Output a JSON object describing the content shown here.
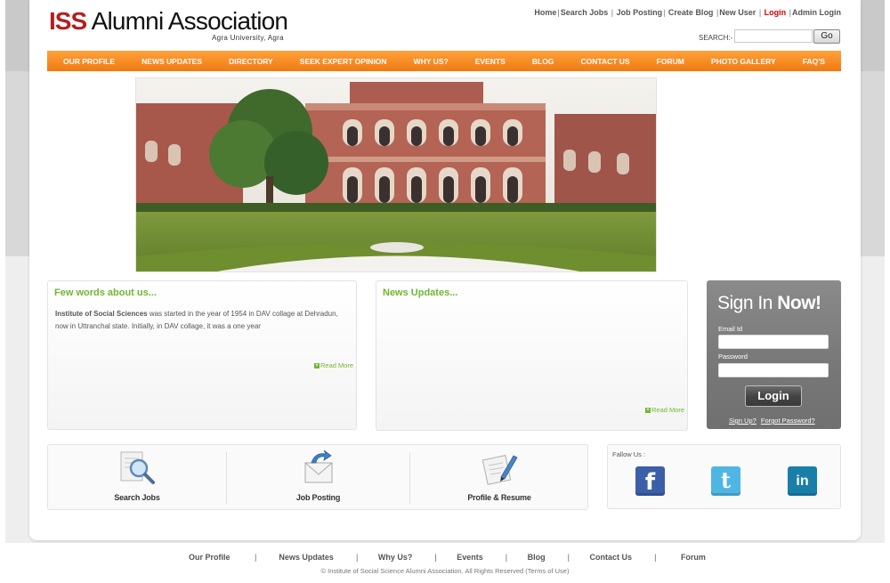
{
  "header": {
    "logo_iss": "ISS",
    "logo_rest": " Alumni Association",
    "logo_sub": "Agra University, Agra",
    "top_links": [
      "Home",
      "Search Jobs",
      "Job Posting",
      "Create Blog",
      "New User",
      "Login",
      "Admin Login"
    ],
    "search_label": "SEARCH:-",
    "search_value": "",
    "search_button": "Go"
  },
  "nav": {
    "items": [
      "OUR PROFILE",
      "NEWS UPDATES",
      "DIRECTORY",
      "SEEK EXPERT OPINION",
      "WHY US?",
      "EVENTS",
      "BLOG",
      "CONTACT US",
      "FORUM",
      "PHOTO GALLERY",
      "FAQ'S"
    ]
  },
  "about": {
    "title": "Few words about us...",
    "text_bold": "Institute of Social Sciences",
    "text_rest": " was started in the year of 1954 in DAV collage at Dehradun, now in Uttranchal state. Initially, in DAV collage, it was a one year",
    "read_more": "Read More"
  },
  "news": {
    "title": "News Updates...",
    "read_more": "Read More"
  },
  "signin": {
    "title_light": "Sign In ",
    "title_bold": "Now!",
    "email_label": "Email Id",
    "email_value": "",
    "password_label": "Password",
    "password_value": "",
    "login_button": "Login",
    "signup_link": "Sign Up?",
    "forgot_link": "Forgot Password?"
  },
  "quick_links": [
    {
      "label": "Search Jobs",
      "icon": "magnifier-document-icon"
    },
    {
      "label": "Job Posting",
      "icon": "envelope-arrow-icon"
    },
    {
      "label": "Profile & Resume",
      "icon": "document-pen-icon"
    }
  ],
  "follow": {
    "label": "Fallow Us :",
    "networks": [
      {
        "name": "facebook",
        "glyph": "f",
        "color": "#3b5fa8"
      },
      {
        "name": "twitter",
        "glyph": "t",
        "color": "#4fb6e4"
      },
      {
        "name": "linkedin",
        "glyph": "in",
        "color": "#1a7fa8"
      }
    ]
  },
  "footer": {
    "links": [
      "Our Profile",
      "News Updates",
      "Why Us?",
      "Events",
      "Blog",
      "Contact Us",
      "Forum"
    ],
    "copyright": "© Institute of Social Science Alumni Association. All Rights Reserved (Terms of Use)"
  },
  "colors": {
    "brand_red": "#b41e1e",
    "nav_orange": "#f7891f",
    "accent_green": "#6fb62f"
  }
}
